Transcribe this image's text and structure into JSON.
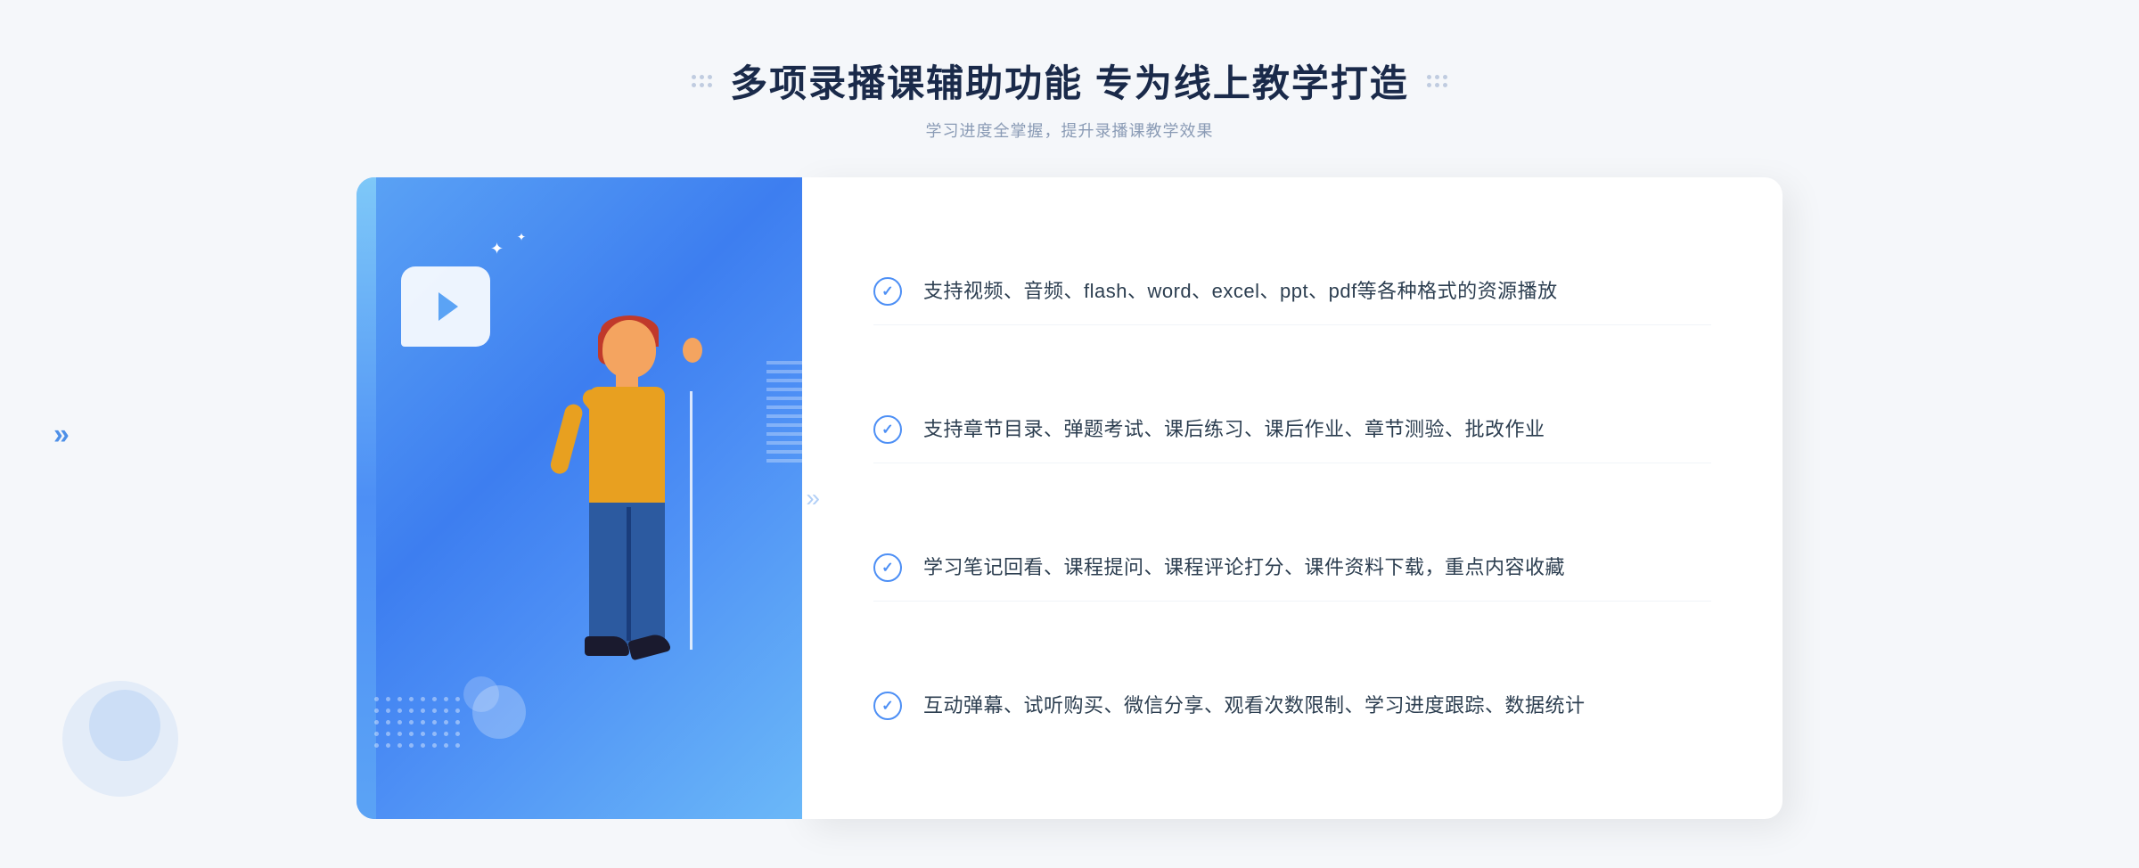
{
  "page": {
    "background_color": "#f5f7fa"
  },
  "header": {
    "main_title": "多项录播课辅助功能 专为线上教学打造",
    "sub_title": "学习进度全掌握，提升录播课教学效果",
    "decoration_dots_left": "···",
    "decoration_dots_right": "···"
  },
  "features": [
    {
      "id": 1,
      "text": "支持视频、音频、flash、word、excel、ppt、pdf等各种格式的资源播放"
    },
    {
      "id": 2,
      "text": "支持章节目录、弹题考试、课后练习、课后作业、章节测验、批改作业"
    },
    {
      "id": 3,
      "text": "学习笔记回看、课程提问、课程评论打分、课件资料下载，重点内容收藏"
    },
    {
      "id": 4,
      "text": "互动弹幕、试听购买、微信分享、观看次数限制、学习进度跟踪、数据统计"
    }
  ],
  "arrows": {
    "left_arrow": "»",
    "right_arrows": "»"
  }
}
